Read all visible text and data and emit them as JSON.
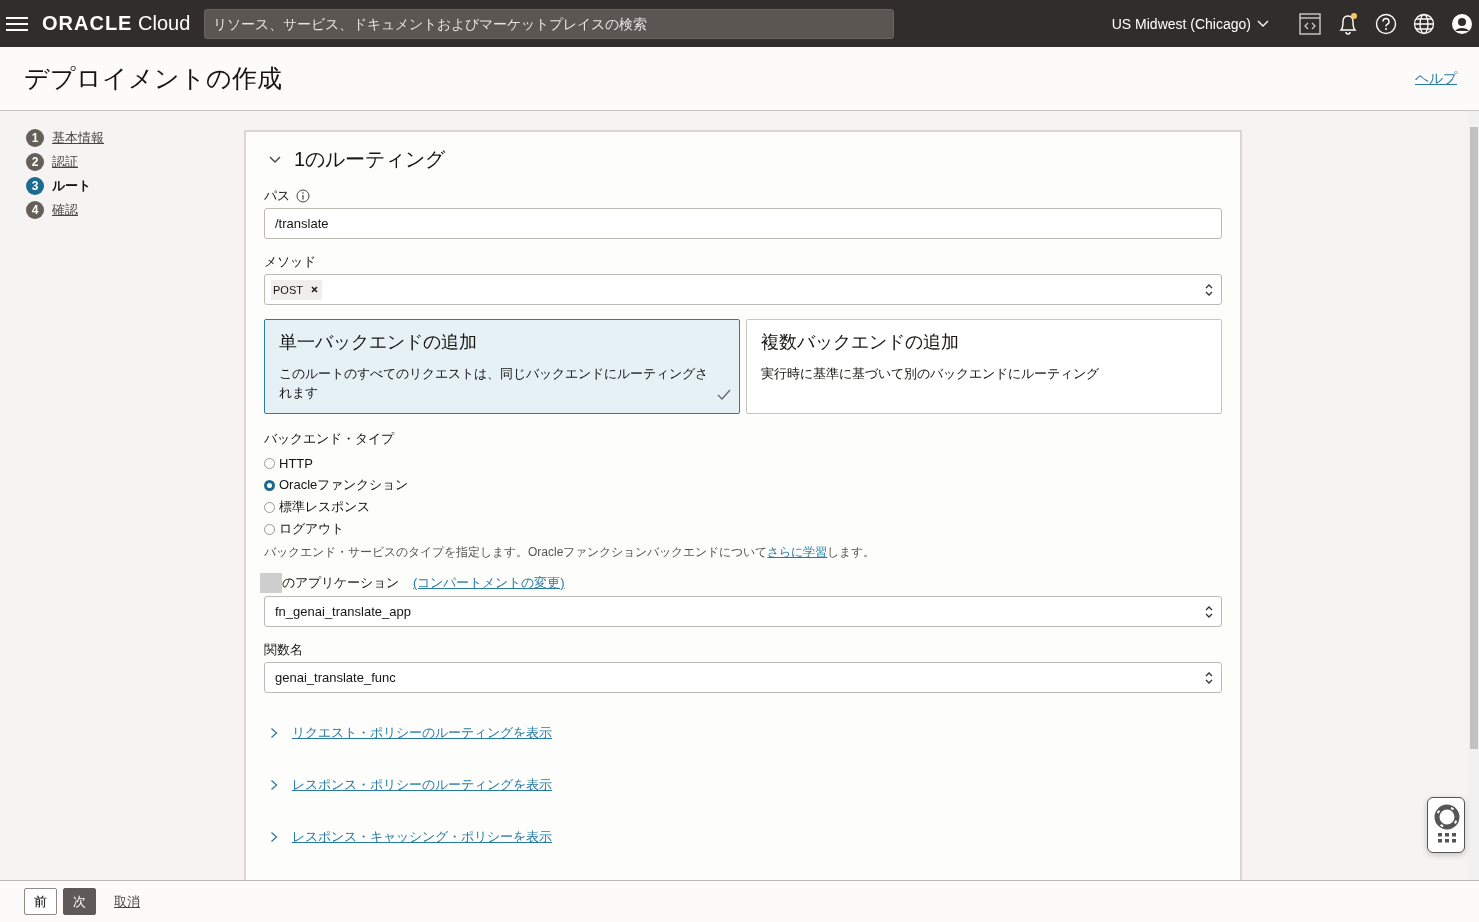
{
  "topbar": {
    "brand": "ORACLE",
    "brand_suffix": "Cloud",
    "search": {
      "placeholder": "リソース、サービス、ドキュメントおよびマーケットプレイスの検索"
    },
    "region": "US Midwest (Chicago)",
    "notification_dot": true
  },
  "header": {
    "title": "デプロイメントの作成",
    "help": "ヘルプ"
  },
  "steps": [
    {
      "number": "1",
      "label": "基本情報",
      "selected": false
    },
    {
      "number": "2",
      "label": "認証",
      "selected": false
    },
    {
      "number": "3",
      "label": "ルート",
      "selected": true
    },
    {
      "number": "4",
      "label": "確認",
      "selected": false
    }
  ],
  "route": {
    "title": "1のルーティング",
    "expanded": true,
    "path": {
      "label": "パス",
      "value": "/translate"
    },
    "method": {
      "label": "メソッド",
      "tags": [
        "POST"
      ]
    },
    "backend_options": [
      {
        "title": "単一バックエンドの追加",
        "description": "このルートのすべてのリクエストは、同じバックエンドにルーティングされます",
        "selected": true
      },
      {
        "title": "複数バックエンドの追加",
        "description": "実行時に基準に基づいて別のバックエンドにルーティング",
        "selected": false
      }
    ],
    "backend_type": {
      "label": "バックエンド・タイプ",
      "options": [
        {
          "label": "HTTP",
          "selected": false
        },
        {
          "label": "Oracleファンクション",
          "selected": true
        },
        {
          "label": "標準レスポンス",
          "selected": false
        },
        {
          "label": "ログアウト",
          "selected": false
        }
      ],
      "help_before": "バックエンド・サービスのタイプを指定します。Oracleファンクションバックエンドについて",
      "help_link": "さらに学習",
      "help_after": "します。"
    },
    "application": {
      "label": "のアプリケーション",
      "link": "(コンパートメントの変更)",
      "value": "fn_genai_translate_app"
    },
    "function": {
      "label": "関数名",
      "value": "genai_translate_func"
    },
    "policy_links": [
      "リクエスト・ポリシーのルーティングを表示",
      "レスポンス・ポリシーのルーティングを表示",
      "レスポンス・キャッシング・ポリシーを表示"
    ]
  },
  "footer": {
    "buttons": [
      {
        "label": "前",
        "kind": "secondary"
      },
      {
        "label": "次",
        "kind": "primary"
      }
    ],
    "cancel": "取消"
  }
}
